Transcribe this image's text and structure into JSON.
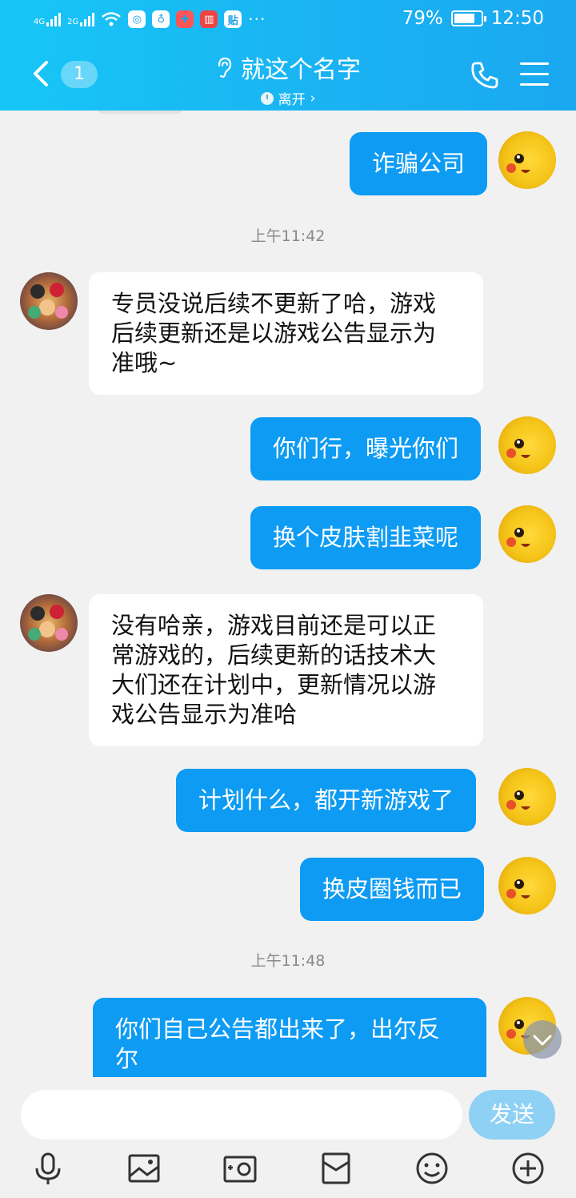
{
  "status_bar": {
    "net1": "4G",
    "net2": "2G",
    "battery_pct": "79%",
    "battery_level": 0.79,
    "time": "12:50",
    "more": "···",
    "app_icon_badge": "贴"
  },
  "header": {
    "unread_count": "1",
    "title": "就这个名字",
    "status": "离开",
    "status_chevron": "›"
  },
  "messages": [
    {
      "side": "out",
      "text": "诈骗公司"
    },
    {
      "time": "上午11:42"
    },
    {
      "side": "in",
      "lines": [
        "专员没说后续不更新了哈，游戏",
        "后续更新还是以游戏公告显示为",
        "准哦~"
      ]
    },
    {
      "side": "out",
      "text": "你们行，曝光你们"
    },
    {
      "side": "out",
      "text": "换个皮肤割韭菜呢"
    },
    {
      "side": "in",
      "lines": [
        "没有哈亲，游戏目前还是可以正",
        "常游戏的，后续更新的话技术大",
        "大们还在计划中，更新情况以游",
        "戏公告显示为准哈"
      ]
    },
    {
      "side": "out",
      "text": "计划什么，都开新游戏了"
    },
    {
      "side": "out",
      "text": "换皮圈钱而已"
    },
    {
      "time": "上午11:48"
    },
    {
      "side": "out",
      "lines": [
        "你们自己公告都出来了，出尔反",
        "尔"
      ]
    }
  ],
  "composer": {
    "input_value": "",
    "send_label": "发送"
  },
  "toolbar": {
    "icons": [
      "microphone-icon",
      "image-icon",
      "camera-icon",
      "red-packet-icon",
      "emoji-icon",
      "plus-icon"
    ]
  },
  "colors": {
    "header": "#1ab2f2",
    "bubble_out": "#0d9bf3",
    "bubble_in": "#ffffff",
    "background": "#f1f1f1",
    "send_button": "#8fd0f5"
  }
}
